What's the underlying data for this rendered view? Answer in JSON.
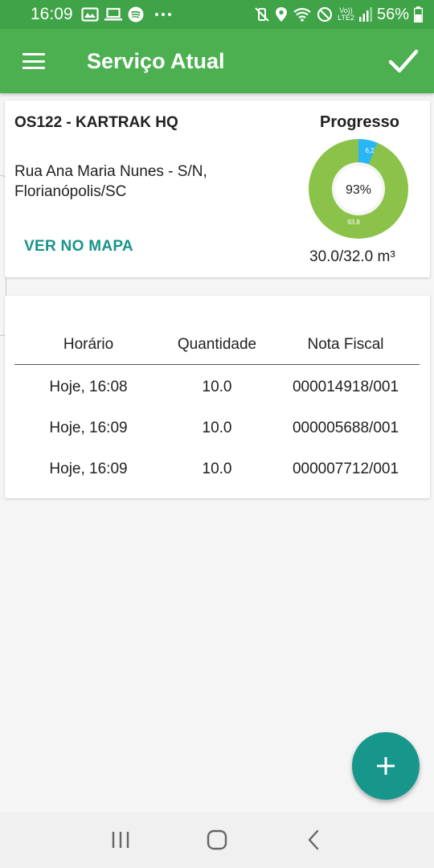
{
  "status_bar": {
    "time": "16:09",
    "battery": "56%",
    "network": "LTE2",
    "volte": "Vo))"
  },
  "app_bar": {
    "title": "Serviço Atual"
  },
  "service": {
    "order": "OS122 - KARTRAK HQ",
    "address": "Rua Ana Maria Nunes - S/N, Florianópolis/SC",
    "map_link": "VER NO MAPA"
  },
  "progress": {
    "title": "Progresso",
    "center_label": "93%",
    "slice_large_label": "93,8",
    "slice_small_label": "6,2",
    "percent_done": 93.8,
    "volume": "30.0/32.0 m³",
    "colors": {
      "done": "#8bc34a",
      "remaining": "#29b6f6"
    }
  },
  "table": {
    "headers": [
      "Horário",
      "Quantidade",
      "Nota Fiscal"
    ],
    "rows": [
      [
        "Hoje, 16:08",
        "10.0",
        "000014918/001"
      ],
      [
        "Hoje, 16:09",
        "10.0",
        "000005688/001"
      ],
      [
        "Hoje, 16:09",
        "10.0",
        "000007712/001"
      ]
    ]
  },
  "colors": {
    "primary": "#4caf50",
    "status_bar": "#3fa347",
    "accent": "#17968b"
  },
  "icons": {
    "menu": "menu-icon",
    "confirm": "check-icon",
    "add": "plus-icon"
  }
}
